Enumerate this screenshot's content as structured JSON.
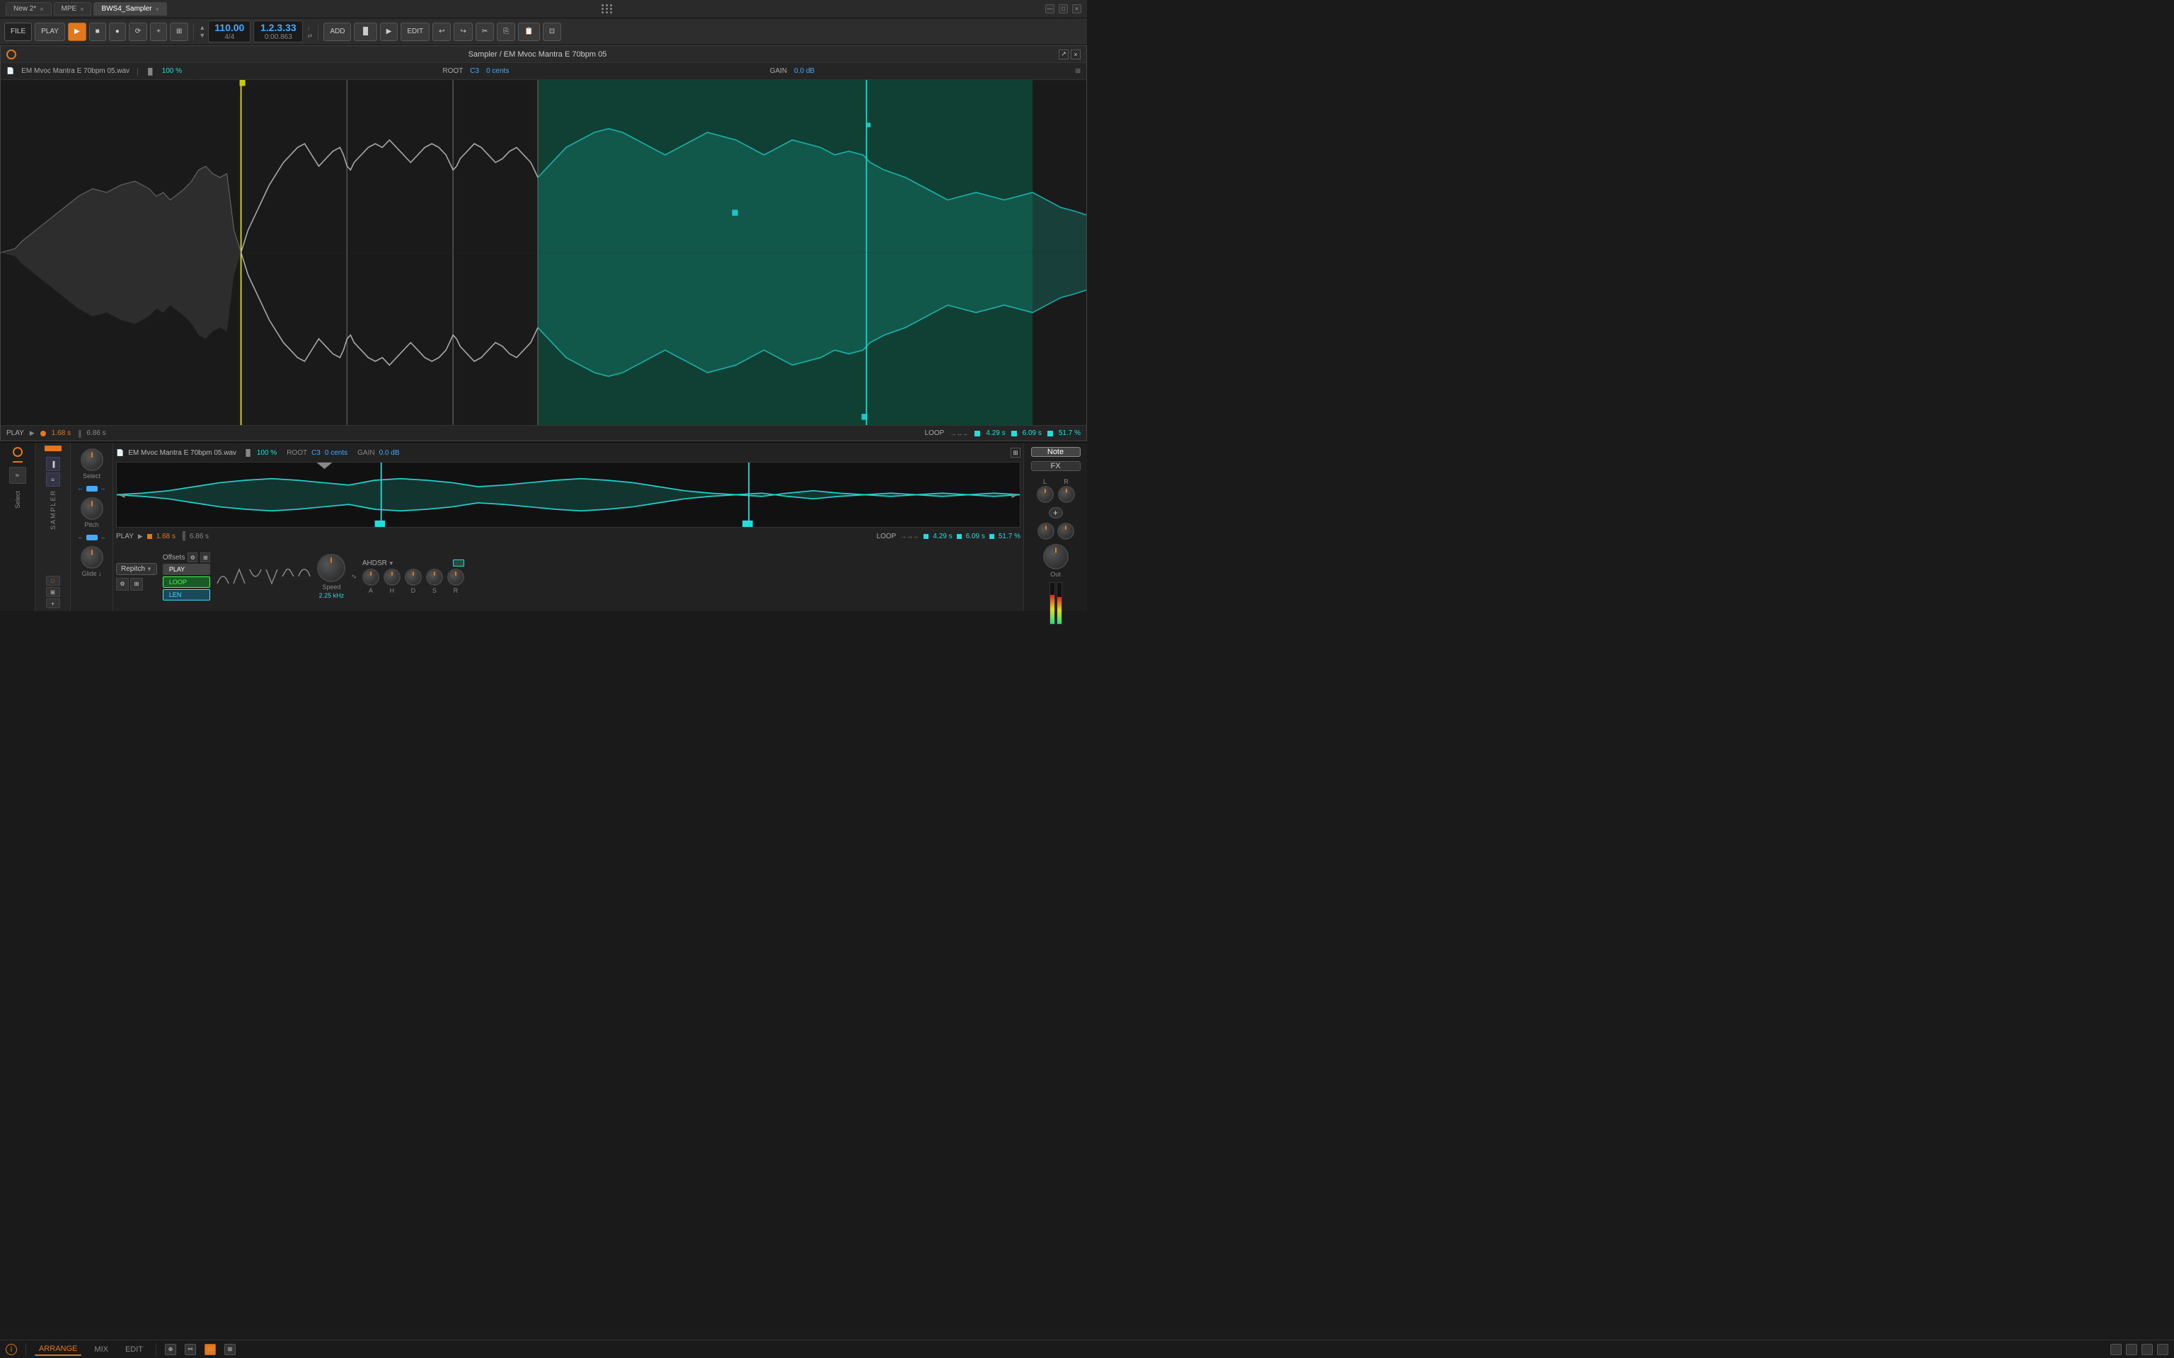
{
  "titlebar": {
    "tabs": [
      {
        "label": "New 2*",
        "active": false,
        "id": "new2"
      },
      {
        "label": "MPE",
        "active": false,
        "id": "mpe"
      },
      {
        "label": "BWS4_Sampler",
        "active": true,
        "id": "bws4"
      }
    ],
    "window_controls": [
      "minimize",
      "maximize",
      "close"
    ]
  },
  "toolbar": {
    "file_label": "FILE",
    "play_label": "PLAY",
    "tempo": "110.00",
    "time_sig": "4/4",
    "position": "1.2.3.33",
    "position2": "0:00.863",
    "add_label": "ADD",
    "edit_label": "EDIT"
  },
  "sampler": {
    "title": "Sampler / EM Mvoc Mantra E 70bpm 05",
    "filename": "EM Mvoc Mantra E 70bpm 05.wav",
    "zoom": "100 %",
    "root": "C3",
    "cents": "0 cents",
    "gain": "0.0 dB",
    "play_pos": "1.68 s",
    "total_len": "6.86 s",
    "loop_label": "LOOP",
    "loop_start": "4.29 s",
    "loop_end": "6.09 s",
    "loop_pct": "51.7 %"
  },
  "bottom_sampler": {
    "filename": "EM Mvoc Mantra E 70bpm 05.wav",
    "zoom": "100 %",
    "root": "C3",
    "cents": "0 cents",
    "gain": "0.0 dB",
    "play_label": "PLAY",
    "play_pos": "1.68 s",
    "total_len": "6.86 s",
    "loop_label": "LOOP",
    "loop_start": "4.29 s",
    "loop_end": "6.09 s",
    "loop_pct": "51.7 %",
    "repitch_label": "Repitch",
    "offsets_label": "Offsets",
    "play_btn": "PLAY",
    "loop_btn": "LOOP",
    "len_btn": "LEN",
    "speed_label": "Speed",
    "freq_label": "2.25 kHz",
    "ahdsr_label": "AHDSR",
    "a_label": "A",
    "h_label": "H",
    "d_label": "D",
    "s_label": "S",
    "r_label": "R",
    "out_label": "Out",
    "note_btn": "Note",
    "fx_btn": "FX",
    "select_label": "Select",
    "pitch_label": "Pitch",
    "glide_label": "Glide"
  },
  "footer": {
    "arrange_label": "ARRANGE",
    "mix_label": "MIX",
    "edit_label": "EDIT",
    "info_label": "i"
  }
}
